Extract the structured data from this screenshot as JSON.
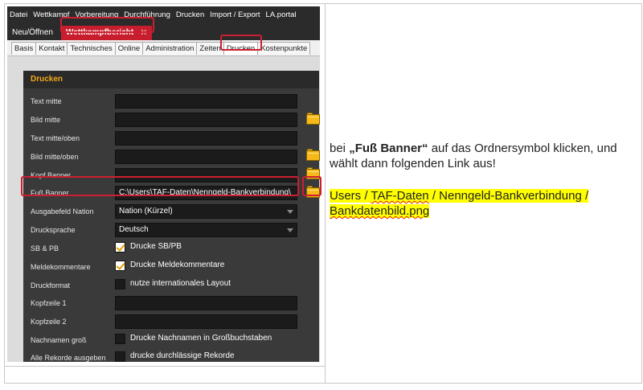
{
  "menubar": {
    "items": [
      "Datei",
      "Wettkampf",
      "Vorbereitung",
      "Durchführung",
      "Drucken",
      "Import / Export",
      "LA.portal"
    ]
  },
  "doc_tabs": {
    "open_label": "Neu/Öffnen",
    "active_label": "Wettkampfbericht",
    "close_symbol": "✕"
  },
  "sub_tabs": {
    "items": [
      "Basis",
      "Kontakt",
      "Technisches",
      "Online",
      "Administration",
      "Zeiten",
      "Drucken",
      "Kostenpunkte"
    ],
    "active": "Drucken"
  },
  "panel": {
    "title": "Drucken",
    "rows": {
      "text_mitte": "Text mitte",
      "bild_mitte": "Bild mitte",
      "text_mitte_oben": "Text mitte/oben",
      "bild_mitte_oben": "Bild mitte/oben",
      "kopf_banner": "Kopf Banner",
      "fuss_banner": "Fuß Banner",
      "fuss_banner_value": "C:\\Users\\TAF-Daten\\Nenngeld-Bankverbindung\\",
      "ausgabefeld_nation": "Ausgabefeld Nation",
      "ausgabefeld_nation_value": "Nation (Kürzel)",
      "drucksprache": "Drucksprache",
      "drucksprache_value": "Deutsch",
      "sb_pb": "SB & PB",
      "sb_pb_value": "Drucke SB/PB",
      "meldekommentare": "Meldekommentare",
      "meldekommentare_value": "Drucke Meldekommentare",
      "druckformat": "Druckformat",
      "druckformat_value": "nutze internationales Layout",
      "kopfzeile1": "Kopfzeile 1",
      "kopfzeile2": "Kopfzeile 2",
      "nachnamen_gross": "Nachnamen groß",
      "nachnamen_gross_value": "Drucke Nachnamen in Großbuchstaben",
      "alle_rekorde": "Alle Rekorde ausgeben",
      "alle_rekorde_value": "drucke durchlässige Rekorde"
    },
    "checkboxes": {
      "sb_pb": true,
      "meldekommentare": true,
      "druckformat": false,
      "nachnamen_gross": false,
      "alle_rekorde": false
    }
  },
  "instruction": {
    "prefix": "bei ",
    "bold": "„Fuß Banner“",
    "suffix": " auf das Ordnersymbol klicken, und wählt dann folgenden Link aus!",
    "path_part1": "Users / ",
    "path_part2": "TAF-Daten",
    "path_part3": " / Nenngeld-Bankverbindung / ",
    "path_part4": "Bankdatenbild.png"
  },
  "colors": {
    "highlight_red": "#cc1f2f",
    "accent_orange": "#f2a818",
    "text_highlight_yellow": "#ffff00"
  }
}
